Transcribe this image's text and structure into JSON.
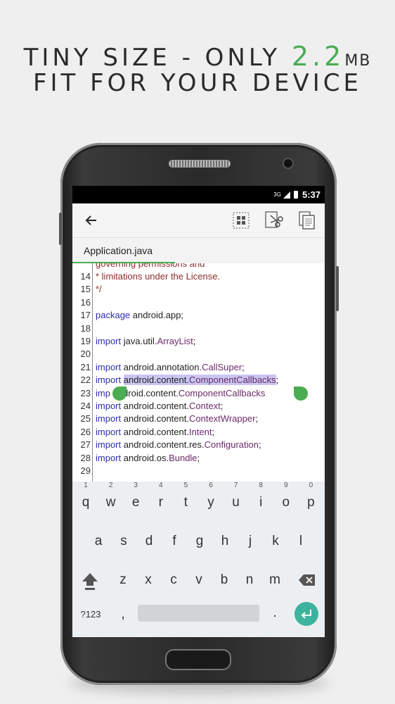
{
  "headline": {
    "line1_prefix": "TINY SIZE - ONLY ",
    "line1_highlight": "2.2",
    "line1_unit": "MB",
    "line2": "FIT FOR YOUR DEVICE",
    "highlight_color": "#4aad52"
  },
  "status_bar": {
    "network": "3G",
    "time": "5:37"
  },
  "toolbar": {
    "back_icon": "arrow-left-icon",
    "select_all_icon": "select-all-icon",
    "cut_icon": "cut-icon",
    "copy_icon": "copy-icon"
  },
  "tab": {
    "label": "Application.java"
  },
  "editor": {
    "partial_line": "governing permissions and",
    "lines": [
      {
        "n": "14",
        "segments": [
          {
            "t": " * limitations under the License.",
            "c": "cm"
          }
        ]
      },
      {
        "n": "15",
        "segments": [
          {
            "t": " */",
            "c": "cm"
          }
        ]
      },
      {
        "n": "16",
        "segments": []
      },
      {
        "n": "17",
        "segments": [
          {
            "t": "package",
            "c": "kw"
          },
          {
            "t": " android.app;",
            "c": "pl"
          }
        ]
      },
      {
        "n": "18",
        "segments": []
      },
      {
        "n": "19",
        "segments": [
          {
            "t": "import",
            "c": "kw"
          },
          {
            "t": " java.util.",
            "c": "pl"
          },
          {
            "t": "ArrayList",
            "c": "cls"
          },
          {
            "t": ";",
            "c": "pl"
          }
        ]
      },
      {
        "n": "20",
        "segments": []
      },
      {
        "n": "21",
        "segments": [
          {
            "t": "import",
            "c": "kw"
          },
          {
            "t": " android.annotation.",
            "c": "pl"
          },
          {
            "t": "CallSuper",
            "c": "cls"
          },
          {
            "t": ";",
            "c": "pl"
          }
        ]
      },
      {
        "n": "22",
        "segments": [
          {
            "t": "import",
            "c": "kw"
          },
          {
            "t": " ",
            "c": "pl"
          },
          {
            "t": "android.content.",
            "c": "pl sel"
          },
          {
            "t": "ComponentCallbacks",
            "c": "cls sel"
          },
          {
            "t": ";",
            "c": "pl"
          }
        ]
      },
      {
        "n": "23",
        "segments": [
          {
            "t": "imp",
            "c": "kw"
          },
          {
            "t": "      android.content.",
            "c": "pl"
          },
          {
            "t": "ComponentCallbacks",
            "c": "cls"
          }
        ]
      },
      {
        "n": "24",
        "segments": [
          {
            "t": "import",
            "c": "kw"
          },
          {
            "t": " android.content.",
            "c": "pl"
          },
          {
            "t": "Context",
            "c": "cls"
          },
          {
            "t": ";",
            "c": "pl"
          }
        ]
      },
      {
        "n": "25",
        "segments": [
          {
            "t": "import",
            "c": "kw"
          },
          {
            "t": " android.content.",
            "c": "pl"
          },
          {
            "t": "ContextWrapper",
            "c": "cls"
          },
          {
            "t": ";",
            "c": "pl"
          }
        ]
      },
      {
        "n": "26",
        "segments": [
          {
            "t": "import",
            "c": "kw"
          },
          {
            "t": " android.content.",
            "c": "pl"
          },
          {
            "t": "Intent",
            "c": "cls"
          },
          {
            "t": ";",
            "c": "pl"
          }
        ]
      },
      {
        "n": "27",
        "segments": [
          {
            "t": "import",
            "c": "kw"
          },
          {
            "t": " android.content.res.",
            "c": "pl"
          },
          {
            "t": "Configuration",
            "c": "cls"
          },
          {
            "t": ";",
            "c": "pl"
          }
        ]
      },
      {
        "n": "28",
        "segments": [
          {
            "t": "import",
            "c": "kw"
          },
          {
            "t": " android.os.",
            "c": "pl"
          },
          {
            "t": "Bundle",
            "c": "cls"
          },
          {
            "t": ";",
            "c": "pl"
          }
        ]
      },
      {
        "n": "29",
        "segments": []
      }
    ]
  },
  "keyboard": {
    "row1": [
      {
        "k": "q",
        "h": "1"
      },
      {
        "k": "w",
        "h": "2"
      },
      {
        "k": "e",
        "h": "3"
      },
      {
        "k": "r",
        "h": "4"
      },
      {
        "k": "t",
        "h": "5"
      },
      {
        "k": "y",
        "h": "6"
      },
      {
        "k": "u",
        "h": "7"
      },
      {
        "k": "i",
        "h": "8"
      },
      {
        "k": "o",
        "h": "9"
      },
      {
        "k": "p",
        "h": "0"
      }
    ],
    "row2": [
      "a",
      "s",
      "d",
      "f",
      "g",
      "h",
      "j",
      "k",
      "l"
    ],
    "row3": [
      "z",
      "x",
      "c",
      "v",
      "b",
      "n",
      "m"
    ],
    "symbols_label": "?123",
    "comma": ",",
    "period": ".",
    "shift_icon": "shift-icon",
    "backspace_icon": "backspace-icon",
    "enter_icon": "enter-icon",
    "enter_color": "#3db39e"
  }
}
